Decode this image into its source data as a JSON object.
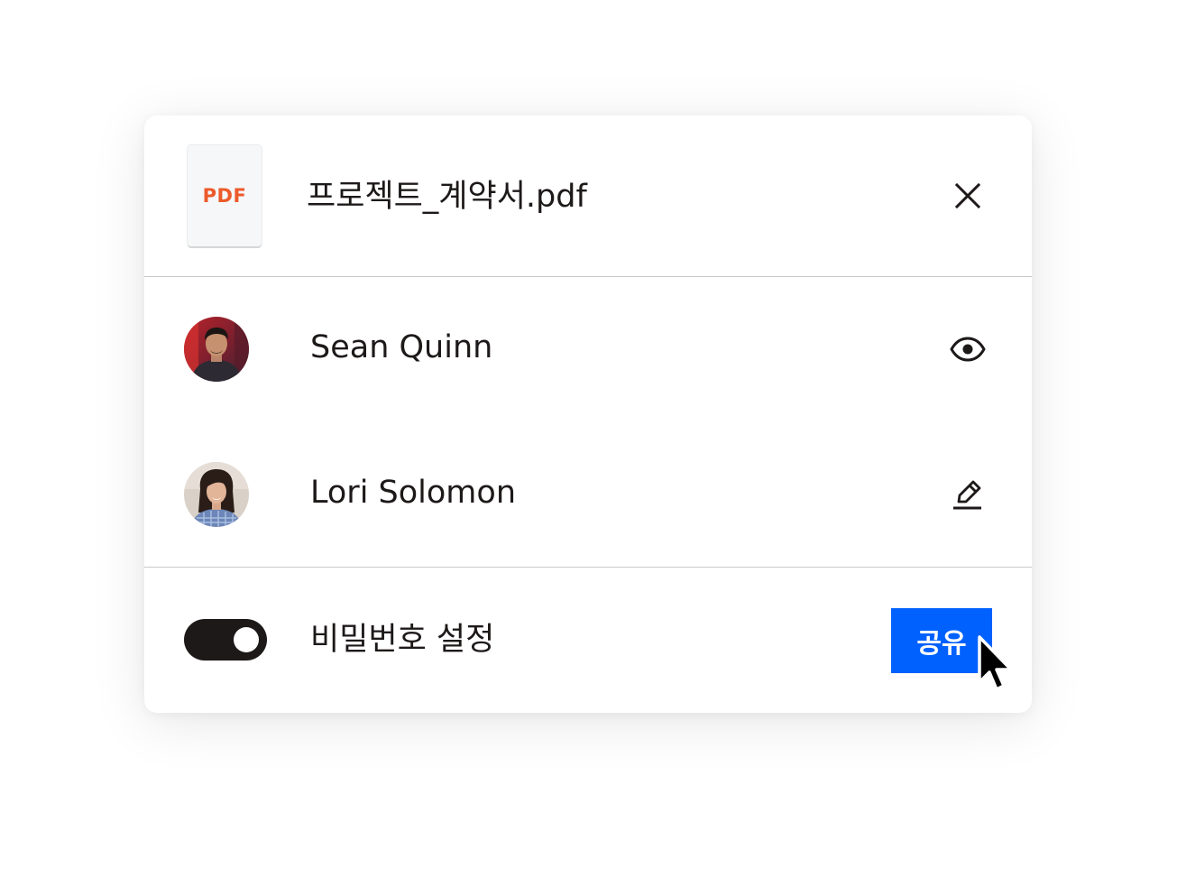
{
  "file": {
    "type_badge": "PDF",
    "name": "프로젝트_계약서.pdf",
    "close_icon": "close-icon"
  },
  "collaborators": [
    {
      "name": "Sean Quinn",
      "permission_icon": "eye-icon",
      "permission": "view"
    },
    {
      "name": "Lori Solomon",
      "permission_icon": "pencil-icon",
      "permission": "edit"
    }
  ],
  "footer": {
    "password_toggle_label": "비밀번호 설정",
    "password_toggle_on": true,
    "share_button_label": "공유"
  },
  "colors": {
    "accent": "#0061fe",
    "pdf_badge": "#ec5a2a",
    "text": "#1e1919",
    "toggle_on": "#1e1919"
  }
}
